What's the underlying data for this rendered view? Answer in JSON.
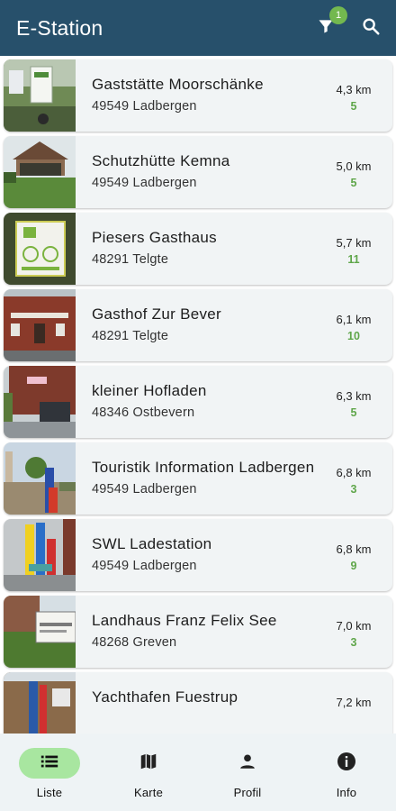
{
  "app": {
    "title": "E-Station"
  },
  "toolbar": {
    "filter_icon": "filter-icon",
    "filter_badge": "1",
    "search_icon": "search-icon"
  },
  "stations": [
    {
      "name": "Gaststätte Moorschänke",
      "address": "49549 Ladbergen",
      "distance": "4,3 km",
      "count": "5"
    },
    {
      "name": "Schutzhütte Kemna",
      "address": "49549 Ladbergen",
      "distance": "5,0 km",
      "count": "5"
    },
    {
      "name": "Piesers Gasthaus",
      "address": "48291 Telgte",
      "distance": "5,7 km",
      "count": "11"
    },
    {
      "name": "Gasthof Zur Bever",
      "address": "48291 Telgte",
      "distance": "6,1 km",
      "count": "10"
    },
    {
      "name": "kleiner Hofladen",
      "address": "48346 Ostbevern",
      "distance": "6,3 km",
      "count": "5"
    },
    {
      "name": "Touristik Information Ladbergen",
      "address": "49549 Ladbergen",
      "distance": "6,8 km",
      "count": "3"
    },
    {
      "name": "SWL Ladestation",
      "address": "49549 Ladbergen",
      "distance": "6,8 km",
      "count": "9"
    },
    {
      "name": "Landhaus Franz Felix See",
      "address": "48268 Greven",
      "distance": "7,0 km",
      "count": "3"
    },
    {
      "name": "Yachthafen Fuestrup",
      "address": "",
      "distance": "7,2 km",
      "count": ""
    }
  ],
  "nav": [
    {
      "label": "Liste",
      "icon": "list-icon",
      "active": true
    },
    {
      "label": "Karte",
      "icon": "map-icon",
      "active": false
    },
    {
      "label": "Profil",
      "icon": "person-icon",
      "active": false
    },
    {
      "label": "Info",
      "icon": "info-icon",
      "active": false
    }
  ],
  "colors": {
    "appbar": "#27506b",
    "accent": "#5fa64a",
    "badge": "#73b84f",
    "nav_active": "#a8e6a0",
    "card": "#f1f4f5"
  }
}
